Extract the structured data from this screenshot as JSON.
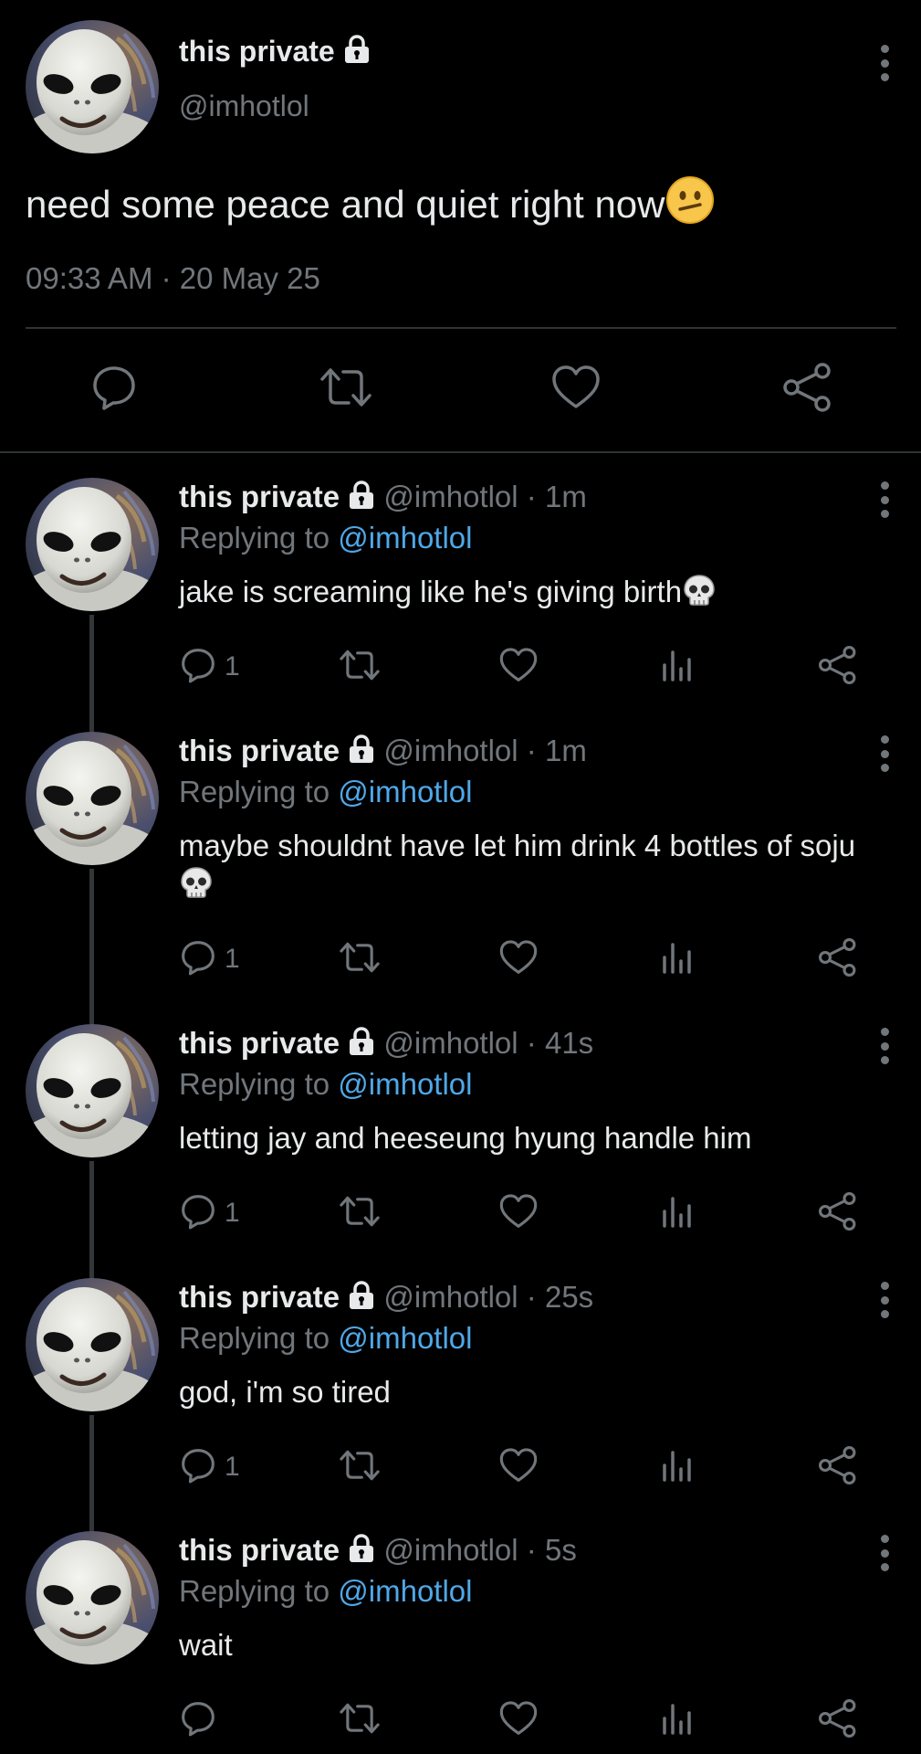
{
  "main_tweet": {
    "display_name": "this private",
    "handle": "@imhotlol",
    "text": "need some peace and quiet right now",
    "emoji": "face-with-diagonal-mouth",
    "time": "09:33 AM",
    "separator": "·",
    "date": "20 May 25",
    "icons": [
      "reply-icon",
      "retweet-icon",
      "like-icon",
      "share-icon"
    ]
  },
  "replies": [
    {
      "display_name": "this private",
      "handle": "@imhotlol",
      "time": "1m",
      "replying_prefix": "Replying to",
      "replying_to": "@imhotlol",
      "text": "jake is screaming like he's giving birth",
      "emoji": "skull",
      "reply_count": "1"
    },
    {
      "display_name": "this private",
      "handle": "@imhotlol",
      "time": "1m",
      "replying_prefix": "Replying to",
      "replying_to": "@imhotlol",
      "text": "maybe shouldnt have let him drink 4 bottles of soju",
      "emoji": "skull",
      "reply_count": "1"
    },
    {
      "display_name": "this private",
      "handle": "@imhotlol",
      "time": "41s",
      "replying_prefix": "Replying to",
      "replying_to": "@imhotlol",
      "text": "letting jay and heeseung hyung handle him",
      "emoji": "",
      "reply_count": "1"
    },
    {
      "display_name": "this private",
      "handle": "@imhotlol",
      "time": "25s",
      "replying_prefix": "Replying to",
      "replying_to": "@imhotlol",
      "text": "god, i'm so tired",
      "emoji": "",
      "reply_count": "1"
    },
    {
      "display_name": "this private",
      "handle": "@imhotlol",
      "time": "5s",
      "replying_prefix": "Replying to",
      "replying_to": "@imhotlol",
      "text": "wait",
      "emoji": "",
      "reply_count": ""
    }
  ],
  "meta_separator": "·",
  "colors": {
    "background": "#000000",
    "text": "#e7e9ea",
    "muted": "#71767b",
    "mention": "#4fa8e8",
    "divider": "#2f3336"
  }
}
